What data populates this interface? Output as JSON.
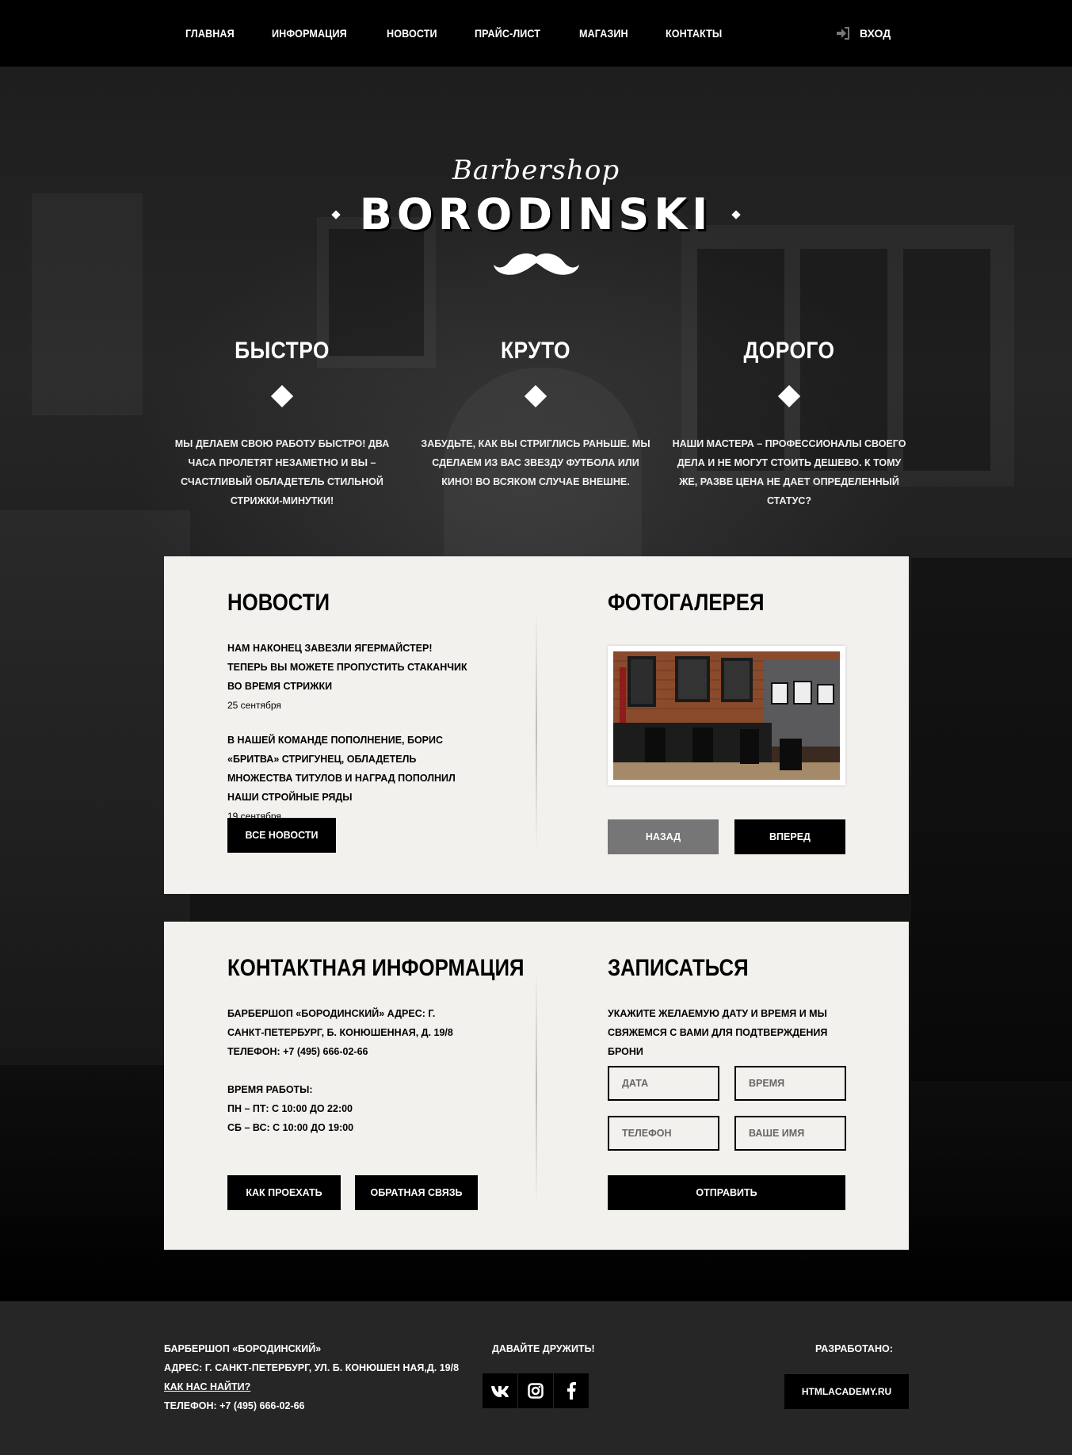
{
  "nav": {
    "items": [
      "ГЛАВНАЯ",
      "ИНФОРМАЦИЯ",
      "НОВОСТИ",
      "ПРАЙС-ЛИСТ",
      "МАГАЗИН",
      "КОНТАКТЫ"
    ],
    "login": "ВХОД"
  },
  "logo": {
    "script": "Barbershop",
    "main": "BORODINSKI"
  },
  "features": [
    {
      "title": "БЫСТРО",
      "text": "МЫ ДЕЛАЕМ СВОЮ РАБОТУ БЫСТРО! ДВА ЧАСА ПРОЛЕТЯТ НЕЗАМЕТНО И ВЫ – СЧАСТЛИВЫЙ ОБЛАДЕТЕЛЬ СТИЛЬНОЙ СТРИЖКИ-МИНУТКИ!"
    },
    {
      "title": "КРУТО",
      "text": "ЗАБУДЬТЕ, КАК ВЫ СТРИГЛИСЬ РАНЬШЕ. МЫ СДЕЛАЕМ ИЗ ВАС ЗВЕЗДУ ФУТБОЛА ИЛИ КИНО! ВО ВСЯКОМ СЛУЧАЕ ВНЕШНЕ."
    },
    {
      "title": "ДОРОГО",
      "text": "НАШИ МАСТЕРА – ПРОФЕССИОНАЛЫ СВОЕГО ДЕЛА И НЕ МОГУТ СТОИТЬ ДЕШЕВО. К ТОМУ ЖЕ, РАЗВЕ ЦЕНА НЕ ДАЕТ ОПРЕДЕЛЕННЫЙ СТАТУС?"
    }
  ],
  "news": {
    "title": "НОВОСТИ",
    "items": [
      {
        "title": "НАМ НАКОНЕЦ ЗАВЕЗЛИ ЯГЕРМАЙСТЕР! ТЕПЕРЬ ВЫ МОЖЕТЕ ПРОПУСТИТЬ СТАКАНЧИК ВО ВРЕМЯ СТРИЖКИ",
        "date": "25 сентября"
      },
      {
        "title": "В НАШЕЙ КОМАНДЕ ПОПОЛНЕНИЕ, БОРИС «БРИТВА» СТРИГУНЕЦ, ОБЛАДЕТЕЛЬ МНОЖЕСТВА ТИТУЛОВ И НАГРАД ПОПОЛНИЛ НАШИ СТРОЙНЫЕ РЯДЫ",
        "date": "19 сентября"
      }
    ],
    "button": "ВСЕ НОВОСТИ"
  },
  "gallery": {
    "title": "ФОТОГАЛЕРЕЯ",
    "prev": "НАЗАД",
    "next": "ВПЕРЕД"
  },
  "contacts": {
    "title": "КОНТАКТНАЯ ИНФОРМАЦИЯ",
    "address_1": "БАРБЕРШОП «БОРОДИНСКИЙ» АДРЕС: Г.",
    "address_2": "САНКТ-ПЕТЕРБУРГ, Б. КОНЮШЕННАЯ, Д. 19/8",
    "phone": "ТЕЛЕФОН: +7 (495) 666-02-66",
    "hours_title": "ВРЕМЯ РАБОТЫ:",
    "hours_1": "ПН – ПТ: С 10:00 ДО 22:00",
    "hours_2": "СБ – ВС: С 10:00 ДО 19:00",
    "route_button": "КАК ПРОЕХАТЬ",
    "feedback_button": "ОБРАТНАЯ СВЯЗЬ"
  },
  "booking": {
    "title": "ЗАПИСАТЬСЯ",
    "text": "УКАЖИТЕ ЖЕЛАЕМУЮ ДАТУ И ВРЕМЯ И МЫ СВЯЖЕМСЯ С ВАМИ ДЛЯ ПОДТВЕРЖДЕНИЯ БРОНИ",
    "date_placeholder": "ДАТА",
    "time_placeholder": "ВРЕМЯ",
    "phone_placeholder": "ТЕЛЕФОН",
    "name_placeholder": "ВАШЕ ИМЯ",
    "submit": "ОТПРАВИТЬ"
  },
  "footer": {
    "name": "БАРБЕРШОП «БОРОДИНСКИЙ»",
    "address": "АДРЕС: Г. САНКТ-ПЕТЕРБУРГ, УЛ. Б. КОНЮШЕН НАЯ,Д. 19/8",
    "directions_link": "КАК НАС НАЙТИ?",
    "phone": "ТЕЛЕФОН: +7 (495) 666-02-66",
    "social_title": "ДАВАЙТЕ ДРУЖИТЬ!",
    "social": [
      "vk-icon",
      "instagram-icon",
      "facebook-icon"
    ],
    "developed_title": "РАЗРАБОТАНО:",
    "developed_button": "HTMLACADEMY.RU"
  }
}
